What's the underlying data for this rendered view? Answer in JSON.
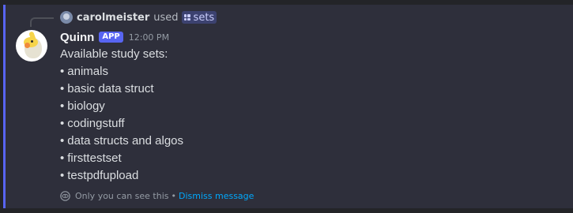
{
  "reply": {
    "username": "carolmeister",
    "used_text": "used",
    "command": "sets"
  },
  "message": {
    "bot_name": "Quinn",
    "badge": "APP",
    "timestamp": "12:00 PM",
    "intro": "Available study sets:",
    "bullet": "•",
    "items": [
      "animals",
      "basic data struct",
      "biology",
      "codingstuff",
      "data structs and algos",
      "firsttestset",
      "testpdfupload"
    ]
  },
  "ephemeral": {
    "notice": "Only you can see this",
    "separator": "•",
    "dismiss_label": "Dismiss message"
  },
  "colors": {
    "background": "#232428",
    "message_highlight": "#2e2f3b",
    "accent": "#5865f2",
    "link": "#00a8fc"
  },
  "icons": {
    "reply_avatar": "user-avatar-icon",
    "command": "app-command-icon",
    "bot_avatar": "cockatiel-avatar",
    "ephemeral": "eye-icon"
  }
}
